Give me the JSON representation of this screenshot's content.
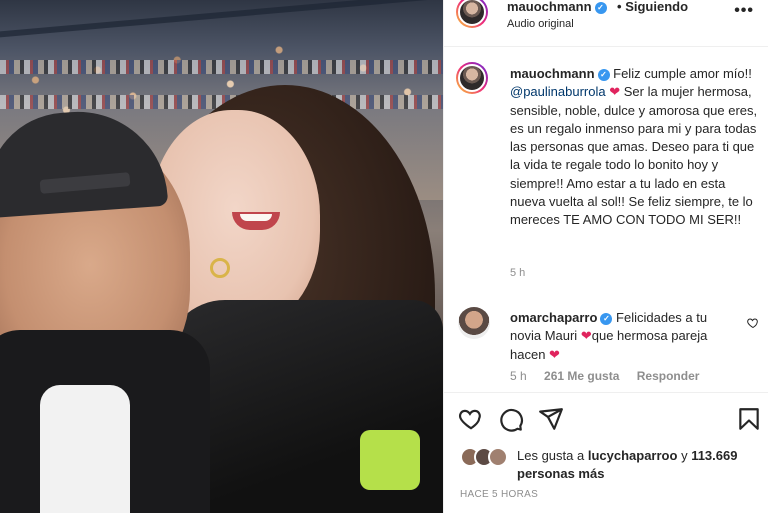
{
  "header": {
    "username": "mauochmann",
    "separator": "•",
    "follow_status": "Siguiendo",
    "audio": "Audio original",
    "more": "•••"
  },
  "caption": {
    "username": "mauochmann",
    "text_before_mention": "Feliz cumple amor mío!!",
    "mention": "@paulinaburrola",
    "heart": "❤",
    "text_after_mention": "Ser la mujer hermosa, sensible, noble, dulce y amorosa que eres, es un regalo inmenso para mi y para todas las personas que amas. Deseo para ti que la vida te regale todo lo bonito hoy y siempre!! Amo estar a tu lado en esta nueva vuelta al sol!! Se feliz siempre, te lo mereces TE AMO CON TODO MI SER!!",
    "time": "5 h"
  },
  "comment": {
    "username": "omarchaparro",
    "text_1": "Felicidades a tu novia Mauri",
    "heart": "❤",
    "text_2": "que hermosa pareja hacen",
    "heart_2": "❤",
    "time": "5 h",
    "likes": "261 Me gusta",
    "reply": "Responder"
  },
  "actions": {
    "icons": [
      "heart-icon",
      "comment-icon",
      "share-icon",
      "bookmark-icon"
    ]
  },
  "likes": {
    "prefix": "Les gusta a",
    "user": "lucychaparroo",
    "conj": "y",
    "count": "113.669 personas más"
  },
  "posted": "HACE 5 HORAS",
  "colors": {
    "link": "#00376b",
    "verified": "#3897f0",
    "heart": "#e0245e",
    "muted": "#8e8e8e"
  }
}
